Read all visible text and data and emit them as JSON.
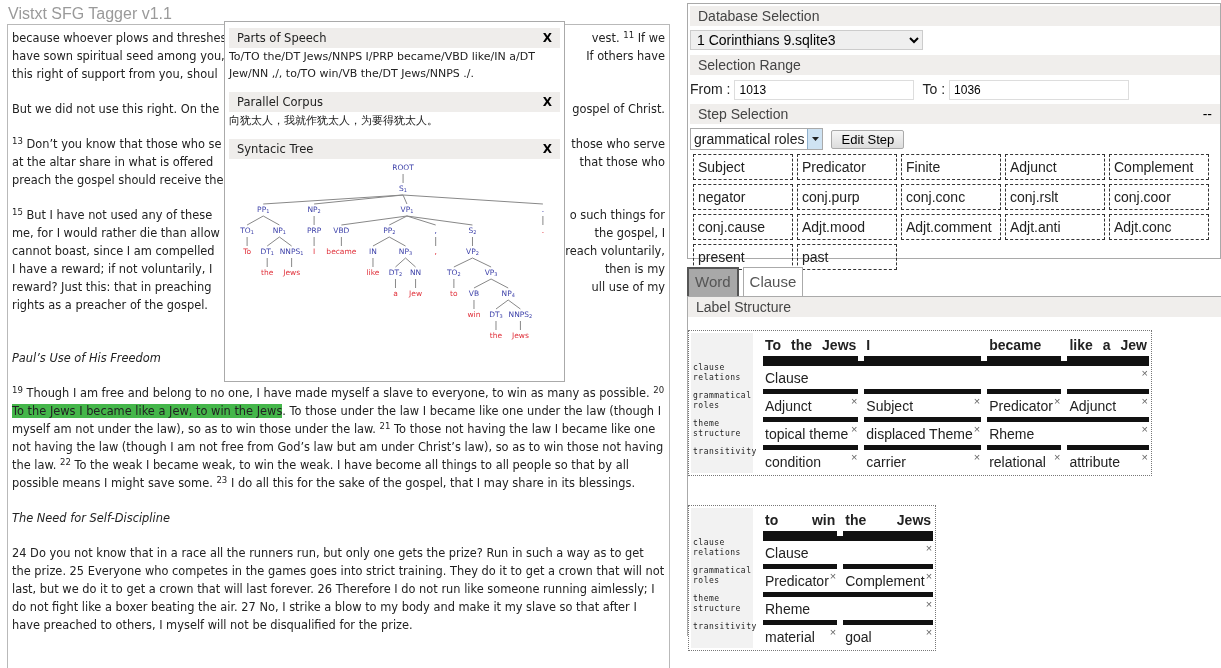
{
  "app_title": "Vistxt SFG Tagger v1.1",
  "reader": {
    "covered_paragraphs": [
      [
        {
          "left": "because whoever plows and threshes",
          "right": "vest. $^{11}$ If we"
        },
        {
          "left": "have sown spiritual seed among you,",
          "right": "If others have"
        },
        {
          "left": "this right of support from you, shoul"
        }
      ],
      [
        {
          "left": "But we did not use this right. On the",
          "right": "gospel of Christ."
        }
      ],
      [
        {
          "left": "$^{13}$ Don’t you know that those who se",
          "right": "those who serve"
        },
        {
          "left": "at the altar share in what is offered",
          "right": "that those who"
        },
        {
          "left": "preach the gospel should receive the"
        }
      ],
      [
        {
          "left": "$^{15}$ But I have not used any of these",
          "right": "o such things for"
        },
        {
          "left": "me, for I would rather die than allow",
          "right": "the gospel, I"
        },
        {
          "left": "cannot boast, since I am compelled",
          "right": "reach voluntarily,"
        },
        {
          "left": "I have a reward; if not voluntarily, I",
          "right": "then is my"
        },
        {
          "left": "reward? Just this: that in preaching",
          "right": "ull use of my"
        },
        {
          "left": "rights as a preacher of the gospel."
        }
      ]
    ],
    "blocks": [
      {
        "kind": "heading",
        "text": "Paul’s Use of His Freedom"
      },
      {
        "kind": "paragraph",
        "text": "$^{19}$ Though I am free and belong to no one, I have made myself a slave to everyone, to win as many as possible. $^{20}$ ",
        "highlight": "To the Jews I became like a Jew, to win the Jews",
        "tail": ". To those under the law I became like one under the law (though I myself am not under the law), so as to win those under the law. $^{21}$ To those not having the law I became like one not having the law (though I am not free from God’s law but am under Christ’s law), so as to win those not having the law. $^{22}$ To the weak I became weak, to win the weak. I have become all things to all people so that by all possible means I might save some. $^{23}$ I do all this for the sake of the gospel, that I may share in its blessings."
      },
      {
        "kind": "heading",
        "text": "The Need for Self-Discipline"
      },
      {
        "kind": "paragraph",
        "text": " 24 Do you not know that in a race all the runners run, but only one gets the prize? Run in such a way as to get the prize. 25 Everyone who competes in the games goes into strict training. They do it to get a crown that will not last, but we do it to get a crown that will last forever. 26 Therefore I do not run like someone running aimlessly; I do not fight like a boxer beating the air. 27 No, I strike a blow to my body and make it my slave so that after I have preached to others, I myself will not be disqualified for the prize."
      }
    ]
  },
  "popup": {
    "parts_of_speech": {
      "title": "Parts of Speech",
      "close": "X",
      "text": "To/TO the/DT Jews/NNPS I/PRP became/VBD like/IN a/DT Jew/NN ,/, to/TO win/VB the/DT Jews/NNPS ./."
    },
    "parallel_corpus": {
      "title": "Parallel Corpus",
      "close": "X",
      "text": "向犹太人，我就作犹太人，为要得犹太人。"
    },
    "syntactic_tree": {
      "title": "Syntacic Tree",
      "close": "X",
      "tree": {
        "tag": "ROOT",
        "children": [
          {
            "tag": "S$_{1}$",
            "children": [
              {
                "tag": "PP$_{1}$",
                "children": [
                  {
                    "tag": "TO$_{1}$",
                    "children": [
                      {
                        "word": "To"
                      }
                    ]
                  },
                  {
                    "tag": "NP$_{1}$",
                    "children": [
                      {
                        "tag": "DT$_{1}$",
                        "children": [
                          {
                            "word": "the"
                          }
                        ]
                      },
                      {
                        "tag": "NNPS$_{1}$",
                        "children": [
                          {
                            "word": "Jews"
                          }
                        ]
                      }
                    ]
                  }
                ]
              },
              {
                "tag": "NP$_{2}$",
                "children": [
                  {
                    "tag": "PRP",
                    "children": [
                      {
                        "word": "I"
                      }
                    ]
                  }
                ]
              },
              {
                "tag": "VP$_{1}$",
                "children": [
                  {
                    "tag": "VBD",
                    "children": [
                      {
                        "word": "became"
                      }
                    ]
                  },
                  {
                    "tag": "PP$_{2}$",
                    "children": [
                      {
                        "tag": "IN",
                        "children": [
                          {
                            "word": "like"
                          }
                        ]
                      },
                      {
                        "tag": "NP$_{3}$",
                        "children": [
                          {
                            "tag": "DT$_{2}$",
                            "children": [
                              {
                                "word": "a"
                              }
                            ]
                          },
                          {
                            "tag": "NN",
                            "children": [
                              {
                                "word": "Jew"
                              }
                            ]
                          }
                        ]
                      }
                    ]
                  },
                  {
                    "tag": ",",
                    "children": [
                      {
                        "word": ","
                      }
                    ]
                  },
                  {
                    "tag": "S$_{2}$",
                    "children": [
                      {
                        "tag": "VP$_{2}$",
                        "children": [
                          {
                            "tag": "TO$_{2}$",
                            "children": [
                              {
                                "word": "to"
                              }
                            ]
                          },
                          {
                            "tag": "VP$_{3}$",
                            "children": [
                              {
                                "tag": "VB",
                                "children": [
                                  {
                                    "word": "win"
                                  }
                                ]
                              },
                              {
                                "tag": "NP$_{4}$",
                                "children": [
                                  {
                                    "tag": "DT$_{3}$",
                                    "children": [
                                      {
                                        "word": "the"
                                      }
                                    ]
                                  },
                                  {
                                    "tag": "NNPS$_{2}$",
                                    "children": [
                                      {
                                        "word": "Jews"
                                      }
                                    ]
                                  }
                                ]
                              }
                            ]
                          }
                        ]
                      }
                    ]
                  }
                ]
              },
              {
                "tag": ".",
                "children": [
                  {
                    "word": "."
                  }
                ]
              }
            ]
          }
        ]
      }
    }
  },
  "database_selection": {
    "title": "Database Selection",
    "database": "1 Corinthians 9.sqlite3"
  },
  "selection_range": {
    "title": "Selection Range",
    "from_label": "From :",
    "from": "1013",
    "to_label": "To :",
    "to": "1036"
  },
  "step_selection": {
    "title": "Step Selection",
    "collapse": "--",
    "step": "grammatical roles",
    "edit_button": "Edit Step",
    "labels": [
      "Subject",
      "Predicator",
      "Finite",
      "Adjunct",
      "Complement",
      "negator",
      "conj.purp",
      "conj.conc",
      "conj.rslt",
      "conj.coor",
      "conj.cause",
      "Adjt.mood",
      "Adjt.comment",
      "Adjt.anti",
      "Adjt.conc",
      "present",
      "past"
    ]
  },
  "tabs": [
    {
      "label": "Word",
      "selected": true
    },
    {
      "label": "Clause",
      "selected": false
    }
  ],
  "label_structure": {
    "title": "Label Structure",
    "tables": [
      {
        "segments": [
          [
            "To",
            "the",
            "Jews"
          ],
          [
            "I"
          ],
          [
            "became"
          ],
          [
            "like",
            "a",
            "Jew"
          ]
        ],
        "rows": [
          {
            "label": "clause relations",
            "cells": [
              {
                "text": "Clause",
                "remove": "×"
              }
            ]
          },
          {
            "label": "grammatical roles",
            "cells": [
              {
                "text": "Adjunct",
                "remove": "×"
              },
              {
                "text": "Subject",
                "remove": "×"
              },
              {
                "text": "Predicator",
                "remove": "×"
              },
              {
                "text": "Adjunct",
                "remove": "×"
              }
            ]
          },
          {
            "label": "theme structure",
            "cells": [
              {
                "text": "topical theme",
                "remove": "×"
              },
              {
                "text": "displaced Theme",
                "remove": "×"
              },
              {
                "text": "Rheme",
                "remove": "×"
              }
            ]
          },
          {
            "label": "transitivity",
            "cells": [
              {
                "text": "condition",
                "remove": "×"
              },
              {
                "text": "carrier",
                "remove": "×"
              },
              {
                "text": "relational",
                "remove": "×"
              },
              {
                "text": "attribute",
                "remove": "×"
              }
            ]
          }
        ]
      },
      {
        "segments": [
          [
            "to",
            "win"
          ],
          [
            "the",
            "Jews"
          ]
        ],
        "rows": [
          {
            "label": "clause relations",
            "cells": [
              {
                "text": "Clause",
                "remove": "×"
              }
            ]
          },
          {
            "label": "grammatical roles",
            "cells": [
              {
                "text": "Predicator",
                "remove": "×"
              },
              {
                "text": "Complement",
                "remove": "×"
              }
            ]
          },
          {
            "label": "theme structure",
            "cells": [
              {
                "text": "Rheme",
                "remove": "×"
              }
            ]
          },
          {
            "label": "transitivity",
            "cells": [
              {
                "text": "material",
                "remove": "×"
              },
              {
                "text": "goal",
                "remove": "×"
              }
            ]
          }
        ]
      }
    ]
  }
}
